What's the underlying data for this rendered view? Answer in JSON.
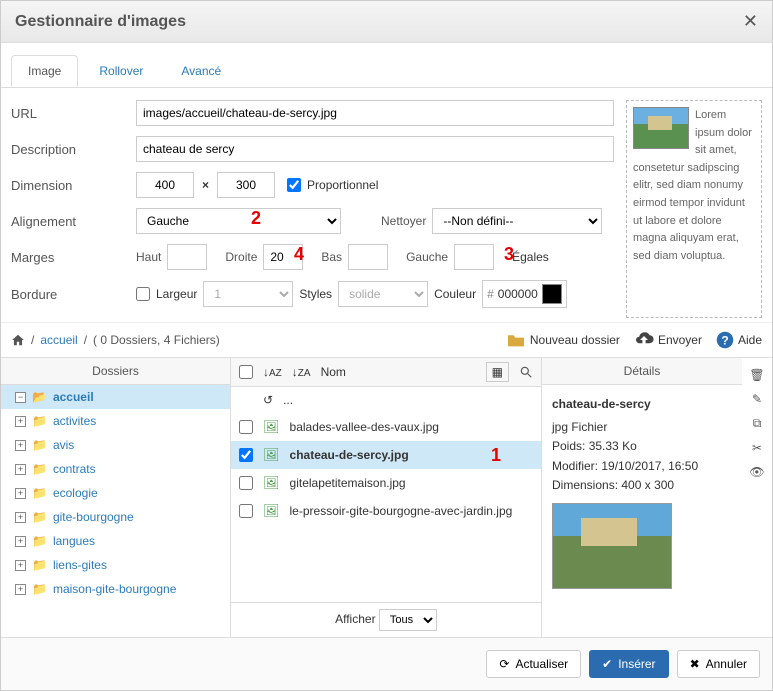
{
  "dialog": {
    "title": "Gestionnaire d'images"
  },
  "tabs": {
    "image": "Image",
    "rollover": "Rollover",
    "advanced": "Avancé"
  },
  "labels": {
    "url": "URL",
    "description": "Description",
    "dimension": "Dimension",
    "proportional": "Proportionnel",
    "alignment": "Alignement",
    "clean": "Nettoyer",
    "margins": "Marges",
    "top": "Haut",
    "right": "Droite",
    "bottom": "Bas",
    "left": "Gauche",
    "equal": "Égales",
    "border": "Bordure",
    "width": "Largeur",
    "styles": "Styles",
    "color": "Couleur"
  },
  "values": {
    "url": "images/accueil/chateau-de-sercy.jpg",
    "description": "chateau de sercy",
    "width": "400",
    "height": "300",
    "alignment": "Gauche",
    "clean": "--Non défini--",
    "margin_right": "20",
    "border_width": "1",
    "border_style": "solide",
    "border_color": "000000"
  },
  "lorem": "Lorem ipsum dolor sit amet, consetetur sadipscing elitr, sed diam nonumy eirmod tempor invidunt ut labore et dolore magna aliquyam erat, sed diam voluptua.",
  "breadcrumb": {
    "root": "accueil",
    "info": "( 0 Dossiers, 4 Fichiers)"
  },
  "actions": {
    "new_folder": "Nouveau dossier",
    "upload": "Envoyer",
    "help": "Aide"
  },
  "cols": {
    "folders": "Dossiers",
    "name": "Nom",
    "details": "Détails"
  },
  "folders": [
    {
      "name": "accueil",
      "active": true,
      "open": true
    },
    {
      "name": "activites"
    },
    {
      "name": "avis"
    },
    {
      "name": "contrats"
    },
    {
      "name": "ecologie"
    },
    {
      "name": "gite-bourgogne"
    },
    {
      "name": "langues"
    },
    {
      "name": "liens-gites"
    },
    {
      "name": "maison-gite-bourgogne"
    }
  ],
  "files": [
    {
      "name": "balades-vallee-des-vaux.jpg"
    },
    {
      "name": "chateau-de-sercy.jpg",
      "selected": true
    },
    {
      "name": "gitelapetitemaison.jpg"
    },
    {
      "name": "le-pressoir-gite-bourgogne-avec-jardin.jpg"
    }
  ],
  "details": {
    "name": "chateau-de-sercy",
    "type": "jpg Fichier",
    "size_label": "Poids:",
    "size": "35.33 Ko",
    "modified_label": "Modifier:",
    "modified": "19/10/2017, 16:50",
    "dim_label": "Dimensions:",
    "dim": "400 x 300"
  },
  "show": {
    "label": "Afficher",
    "value": "Tous"
  },
  "footer": {
    "refresh": "Actualiser",
    "insert": "Insérer",
    "cancel": "Annuler"
  },
  "markers": {
    "m1": "1",
    "m2": "2",
    "m3": "3",
    "m4": "4"
  }
}
